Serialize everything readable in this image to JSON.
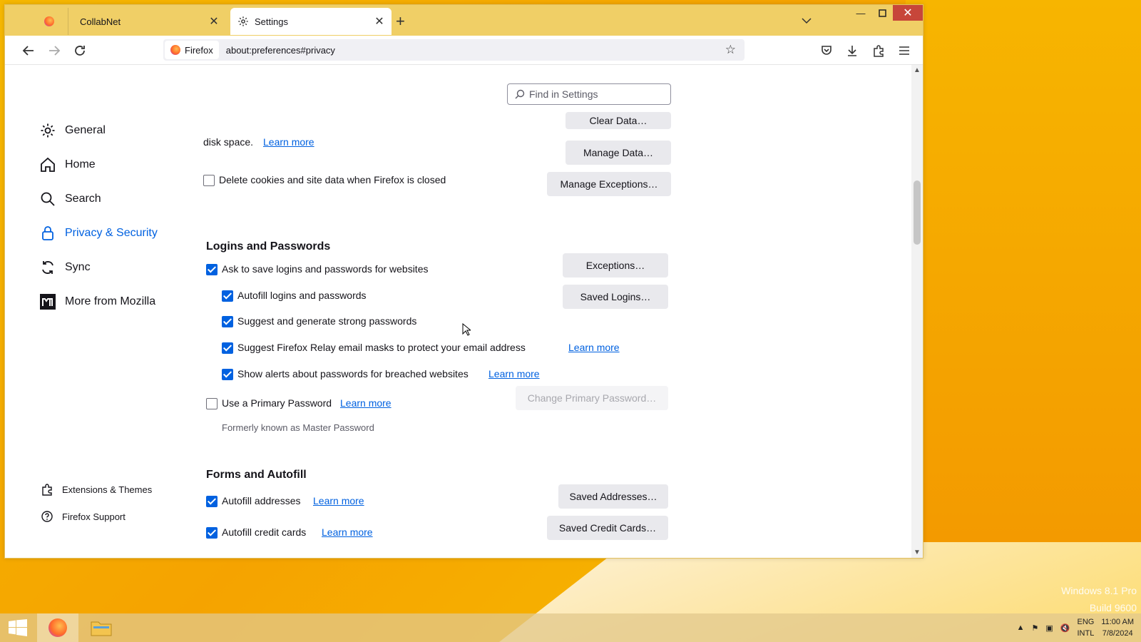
{
  "browser": {
    "tabs": [
      {
        "title": ""
      },
      {
        "title": "CollabNet"
      },
      {
        "title": "Settings"
      }
    ],
    "identity_label": "Firefox",
    "url": "about:preferences#privacy"
  },
  "search": {
    "placeholder": "Find in Settings"
  },
  "sidebar": {
    "items": [
      {
        "label": "General"
      },
      {
        "label": "Home"
      },
      {
        "label": "Search"
      },
      {
        "label": "Privacy & Security"
      },
      {
        "label": "Sync"
      },
      {
        "label": "More from Mozilla"
      }
    ],
    "footer": [
      {
        "label": "Extensions & Themes"
      },
      {
        "label": "Firefox Support"
      }
    ]
  },
  "cookies": {
    "disk_text": "disk space.",
    "learn_more": "Learn more",
    "clear_data": "Clear Data…",
    "manage_data": "Manage Data…",
    "delete_label": "Delete cookies and site data when Firefox is closed",
    "delete_checked": false,
    "manage_exceptions": "Manage Exceptions…"
  },
  "logins": {
    "heading": "Logins and Passwords",
    "ask_save": {
      "label": "Ask to save logins and passwords for websites",
      "checked": true
    },
    "exceptions_btn": "Exceptions…",
    "autofill": {
      "label": "Autofill logins and passwords",
      "checked": true
    },
    "saved_logins_btn": "Saved Logins…",
    "suggest": {
      "label": "Suggest and generate strong passwords",
      "checked": true
    },
    "relay": {
      "label": "Suggest Firefox Relay email masks to protect your email address",
      "checked": true,
      "link": "Learn more"
    },
    "breach": {
      "label": "Show alerts about passwords for breached websites",
      "checked": true,
      "link": "Learn more"
    },
    "primary": {
      "label": "Use a Primary Password",
      "checked": false,
      "link": "Learn more"
    },
    "change_primary_btn": "Change Primary Password…",
    "formerly": "Formerly known as Master Password"
  },
  "forms": {
    "heading": "Forms and Autofill",
    "addresses": {
      "label": "Autofill addresses",
      "checked": true,
      "link": "Learn more"
    },
    "saved_addresses_btn": "Saved Addresses…",
    "cards": {
      "label": "Autofill credit cards",
      "checked": true,
      "link": "Learn more"
    },
    "saved_cards_btn": "Saved Credit Cards…"
  },
  "desktop": {
    "watermark_line1": "Windows 8.1 Pro",
    "watermark_line2": "Build 9600"
  },
  "taskbar": {
    "lang_top": "ENG",
    "lang_bottom": "INTL",
    "time": "11:00 AM",
    "date": "7/8/2024"
  },
  "colors": {
    "accent": "#0061e0",
    "titlebar": "#f0cf66",
    "close": "#c7463a"
  }
}
